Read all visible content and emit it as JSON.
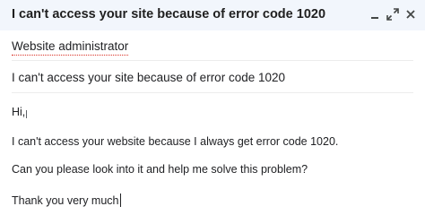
{
  "window": {
    "title": "I can't access your site because of error code 1020",
    "controls": {
      "minimize_icon": "minimize-icon",
      "popout_icon": "popout-icon",
      "close_icon": "close-icon"
    }
  },
  "compose": {
    "recipient": "Website administrator",
    "subject": "I can't access your site because of error code 1020",
    "body": {
      "greeting": "Hi,",
      "paragraph1": "I can't access your website because I always get error code 1020.",
      "paragraph2": "Can you please look into it and help me solve this problem?",
      "closing": "Thank you very much"
    }
  },
  "colors": {
    "titlebar_bg": "#f2f6fc",
    "text": "#202124",
    "recipient_underline": "#d93025"
  }
}
